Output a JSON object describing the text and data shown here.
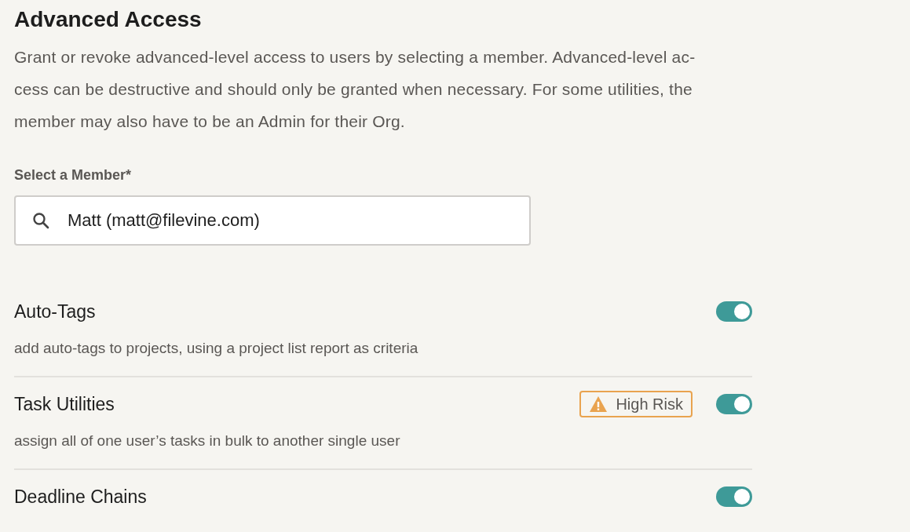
{
  "title": "Advanced Access",
  "description_lines": [
    "Grant or revoke advanced-level access to users by selecting a member. Advanced-level ac-",
    "cess can be destructive and should only be granted when necessary. For some utilities, the",
    "member may also have to be an Admin for their Org."
  ],
  "member_field": {
    "label": "Select a Member*",
    "value": "Matt (matt@filevine.com)"
  },
  "utilities": [
    {
      "name": "Auto-Tags",
      "description": "add auto-tags to projects, using a project list report as criteria",
      "on": true
    },
    {
      "name": "Task Utilities",
      "description": "assign all of one user’s tasks in bulk to another single user",
      "badge": "High Risk",
      "on": true
    },
    {
      "name": "Deadline Chains",
      "on": true
    }
  ]
}
